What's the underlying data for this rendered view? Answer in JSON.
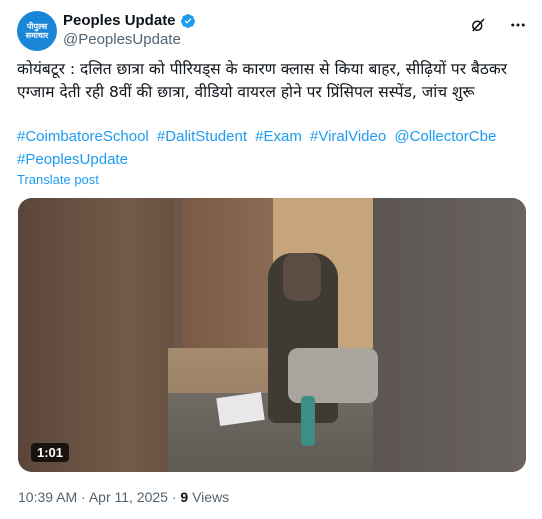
{
  "account": {
    "avatar_text": "पीपुल्स समाचार",
    "display_name": "Peoples Update",
    "handle": "@PeoplesUpdate",
    "verified_color": "#1d9bf0"
  },
  "tweet": {
    "text": "कोयंबटूर : दलित छात्रा को पीरियड्स के कारण क्लास से किया बाहर, सीढ़ियों पर बैठकर एग्जाम देती रही 8वीं की छात्रा, वीडियो वायरल होने पर प्रिंसिपल सस्पेंड, जांच शुरू",
    "hashtags": [
      "#CoimbatoreSchool",
      "#DalitStudent",
      "#Exam",
      "#ViralVideo",
      "#PeoplesUpdate"
    ],
    "mention": "@CollectorCbe",
    "translate_label": "Translate post"
  },
  "media": {
    "duration": "1:01"
  },
  "meta": {
    "timestamp": "10:39 AM · Apr 11, 2025 · ",
    "views_count": "9",
    "views_label": " Views"
  },
  "icons": {
    "grok": "grok-icon",
    "more": "more-icon",
    "verified": "verified-badge-icon"
  },
  "colors": {
    "link": "#1d9bf0",
    "secondary_text": "#536471",
    "avatar_bg": "#1a86d8"
  }
}
